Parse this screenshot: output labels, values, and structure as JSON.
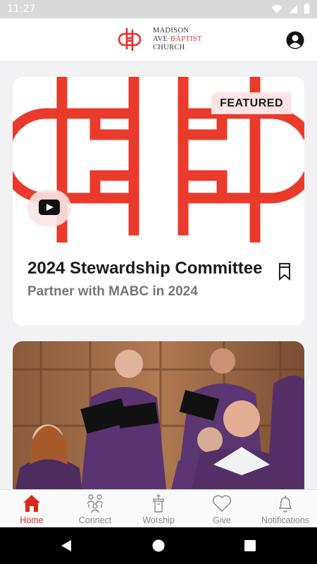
{
  "status_bar": {
    "time": "11:27"
  },
  "header": {
    "logo_lines": [
      "MADISON",
      "AVE",
      "BAPTIST",
      "CHURCH"
    ],
    "brand_color": "#e3322b"
  },
  "feed": {
    "cards": [
      {
        "badge": "FEATURED",
        "title": "2024 Stewardship Committee",
        "subtitle": "Partner with MABC in 2024",
        "media_icon": "youtube-play-icon"
      },
      {
        "media": "choir-photo"
      }
    ]
  },
  "tabs": [
    {
      "label": "Home",
      "icon": "home-icon",
      "active": true
    },
    {
      "label": "Connect",
      "icon": "connect-icon",
      "active": false
    },
    {
      "label": "Worship",
      "icon": "worship-icon",
      "active": false
    },
    {
      "label": "Give",
      "icon": "heart-icon",
      "active": false
    },
    {
      "label": "Notifications",
      "icon": "bell-icon",
      "active": false
    }
  ],
  "colors": {
    "accent": "#d52a1f",
    "inactive": "#888888"
  }
}
